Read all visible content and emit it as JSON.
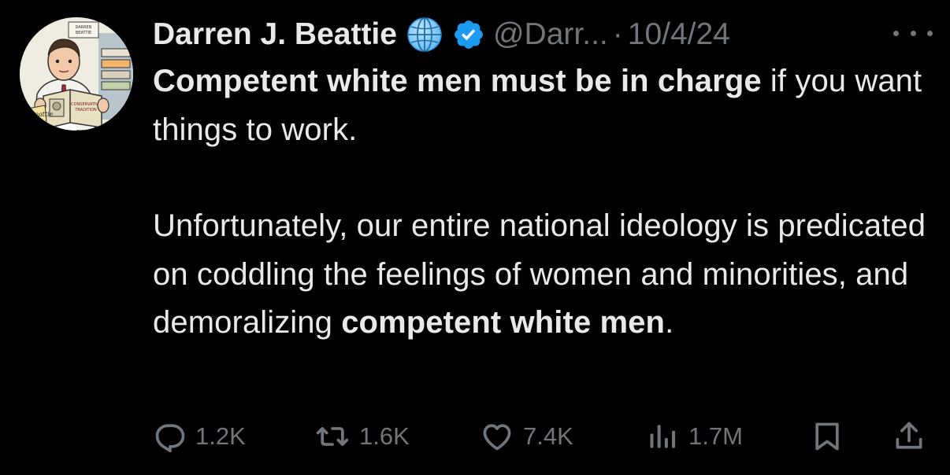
{
  "author": {
    "name": "Darren J. Beattie",
    "handle": "@Darr...",
    "date": "10/4/24",
    "separator": "·",
    "avatar_text": {
      "top": "DARREN BEATTIE",
      "book": "CONSERVATIVE TRADITION",
      "sign": "beattie"
    }
  },
  "tweet": {
    "para1": {
      "bold1": "Competent white men must be in charge",
      "plain1": " if you want things to work."
    },
    "para2": {
      "plain1": "Unfortunately, our entire national ideology is predicated on coddling the feelings of women and minorities, and demoralizing ",
      "bold1": "competent white men",
      "plain2": "."
    }
  },
  "actions": {
    "replies": "1.2K",
    "reposts": "1.6K",
    "likes": "7.4K",
    "views": "1.7M"
  },
  "colors": {
    "background": "#000000",
    "text": "#e7e9ea",
    "muted": "#71767b",
    "verified": "#1d9bf0"
  },
  "icons": [
    "globe-icon",
    "verified-badge-icon",
    "more-icon",
    "reply-icon",
    "repost-icon",
    "like-icon",
    "views-icon",
    "bookmark-icon",
    "share-icon"
  ]
}
